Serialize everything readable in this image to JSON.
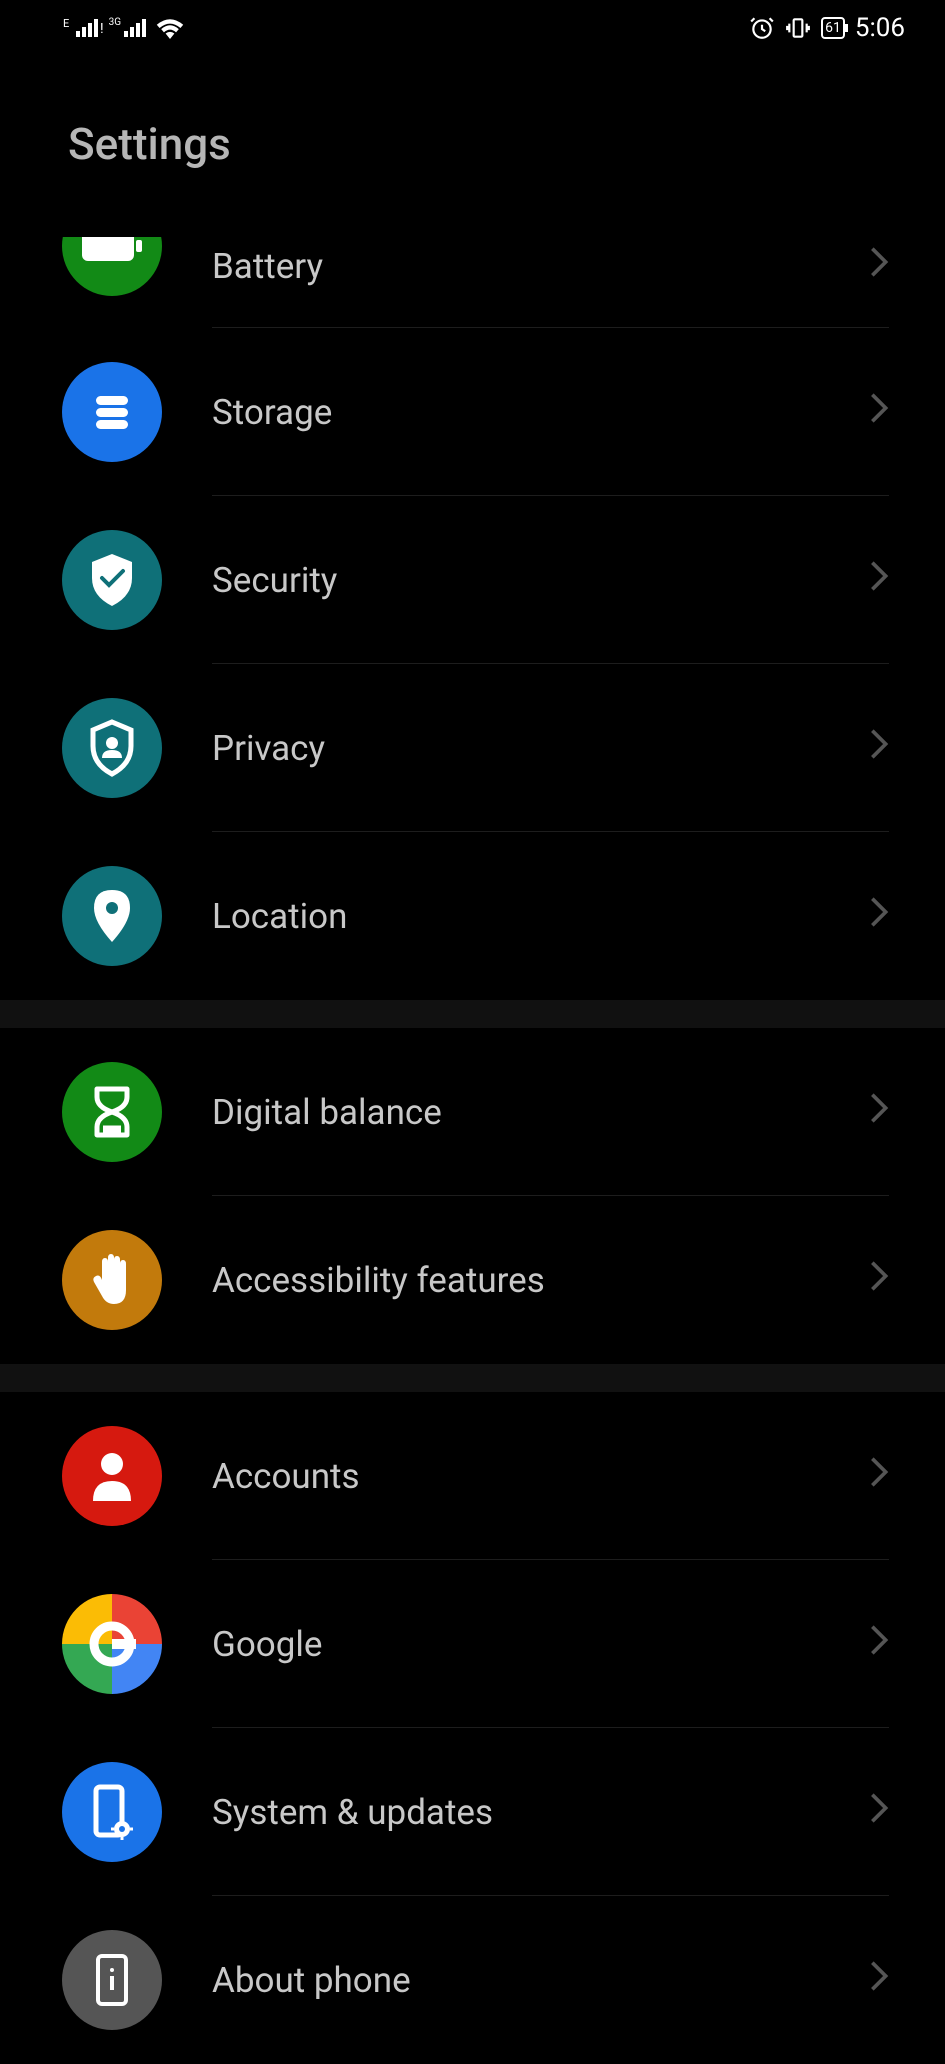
{
  "statusBar": {
    "signal1Label": "E",
    "signal2Label": "3G",
    "batteryPercent": "61",
    "time": "5:06"
  },
  "page": {
    "title": "Settings"
  },
  "sections": [
    {
      "items": [
        {
          "key": "battery",
          "label": "Battery",
          "iconBg": "#128a16",
          "iconName": "battery-icon"
        },
        {
          "key": "storage",
          "label": "Storage",
          "iconBg": "#1a73e8",
          "iconName": "storage-icon"
        },
        {
          "key": "security",
          "label": "Security",
          "iconBg": "#0f7078",
          "iconName": "security-icon"
        },
        {
          "key": "privacy",
          "label": "Privacy",
          "iconBg": "#0f7078",
          "iconName": "privacy-icon"
        },
        {
          "key": "location",
          "label": "Location",
          "iconBg": "#0f7078",
          "iconName": "location-icon"
        }
      ]
    },
    {
      "items": [
        {
          "key": "digital-balance",
          "label": "Digital balance",
          "iconBg": "#128a16",
          "iconName": "hourglass-icon"
        },
        {
          "key": "accessibility",
          "label": "Accessibility features",
          "iconBg": "#c27a0c",
          "iconName": "hand-icon"
        }
      ]
    },
    {
      "items": [
        {
          "key": "accounts",
          "label": "Accounts",
          "iconBg": "#d6190f",
          "iconName": "person-icon"
        },
        {
          "key": "google",
          "label": "Google",
          "iconBg": "google",
          "iconName": "google-icon"
        },
        {
          "key": "system",
          "label": "System & updates",
          "iconBg": "#1a73e8",
          "iconName": "phone-gear-icon"
        },
        {
          "key": "about",
          "label": "About phone",
          "iconBg": "#555555",
          "iconName": "phone-info-icon"
        }
      ]
    }
  ]
}
